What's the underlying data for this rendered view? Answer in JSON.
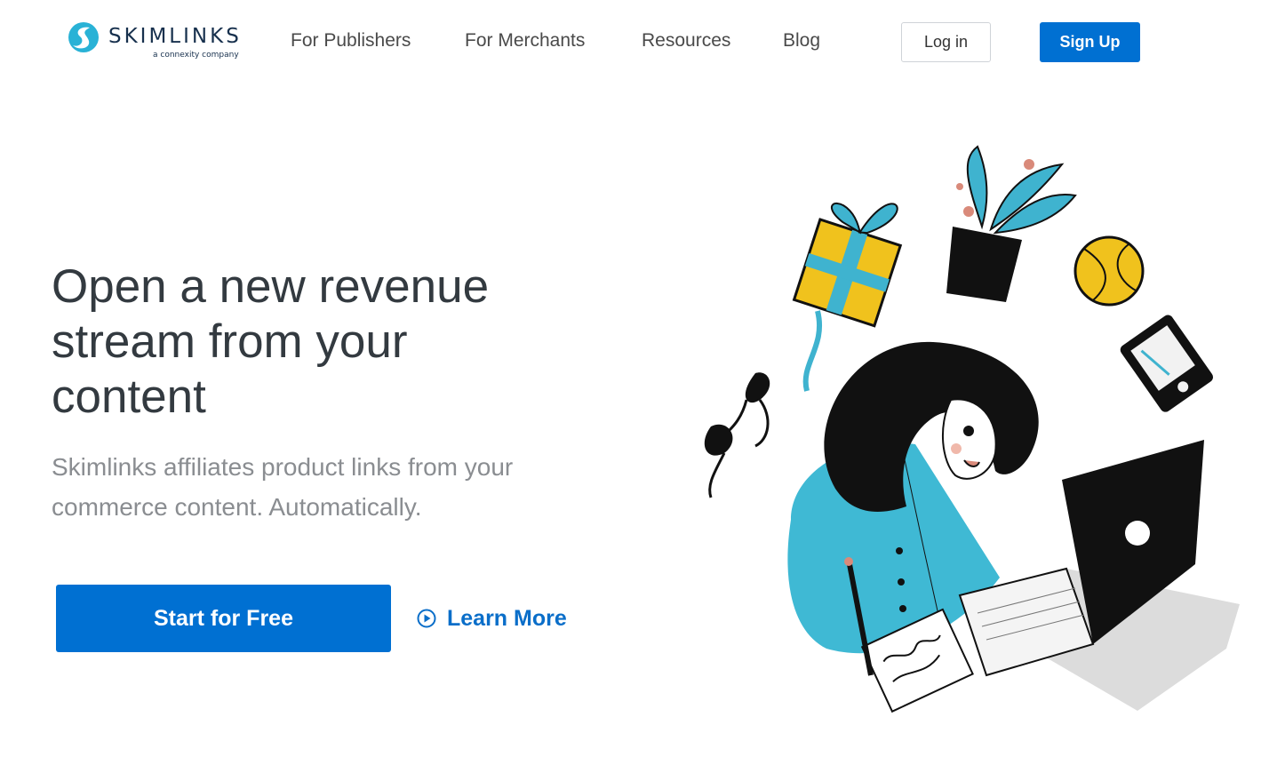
{
  "brand": {
    "name": "SKIMLINKS",
    "tagline": "a connexity company",
    "colors": {
      "primary": "#0070d2",
      "logo_teal": "#29b2d6",
      "logo_navy": "#17304d"
    }
  },
  "nav": {
    "links": [
      "For Publishers",
      "For Merchants",
      "Resources",
      "Blog"
    ],
    "login_label": "Log in",
    "signup_label": "Sign Up"
  },
  "hero": {
    "headline": "Open a new revenue stream from your content",
    "subheadline": "Skimlinks affiliates product links from your commerce content. Automatically.",
    "cta_primary": "Start for Free",
    "cta_secondary": "Learn More",
    "cta_secondary_icon": "play-circle-icon",
    "illustration": "woman-with-laptop-and-floating-products-illustration"
  }
}
